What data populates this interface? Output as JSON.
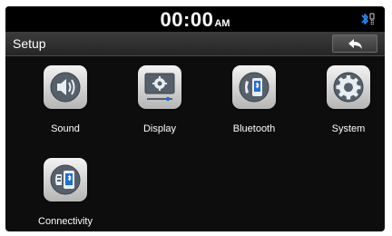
{
  "status": {
    "time": "00:00",
    "ampm": "AM",
    "bluetooth_icon": "bluetooth-status-icon"
  },
  "header": {
    "title": "Setup",
    "back_icon": "back-arrow-icon"
  },
  "menu": [
    {
      "label": "Sound",
      "icon": "speaker-icon"
    },
    {
      "label": "Display",
      "icon": "display-settings-icon"
    },
    {
      "label": "Bluetooth",
      "icon": "bluetooth-phone-icon"
    },
    {
      "label": "System",
      "icon": "gear-icon"
    },
    {
      "label": "Connectivity",
      "icon": "connectivity-icon"
    }
  ],
  "colors": {
    "background": "#0d0d0d",
    "title_bar": "#2e2e2e",
    "icon_tile": "#d9d9d9",
    "icon_badge": "#55606a",
    "bluetooth_accent": "#1f8fff"
  }
}
